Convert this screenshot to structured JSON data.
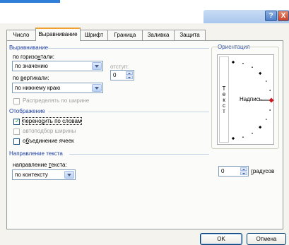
{
  "window": {
    "help_label": "?",
    "close_label": "X"
  },
  "tabs": [
    {
      "label": "Число"
    },
    {
      "label": "Выравнивание",
      "active": true
    },
    {
      "label": "Шрифт"
    },
    {
      "label": "Граница"
    },
    {
      "label": "Заливка"
    },
    {
      "label": "Защита"
    }
  ],
  "alignment": {
    "section_title": "Выравнивание",
    "horizontal_label_pre": "по горизо",
    "horizontal_label_u": "н",
    "horizontal_label_post": "тали:",
    "horizontal_value": "по значению",
    "indent_label": "отступ:",
    "indent_value": "0",
    "vertical_label_pre": "по ",
    "vertical_label_u": "в",
    "vertical_label_post": "ертикали:",
    "vertical_value": "по нижнему краю",
    "distributed_label": "Распределять по ширине"
  },
  "display": {
    "section_title": "Отображение",
    "wrap_label_pre": "перено",
    "wrap_label_u": "с",
    "wrap_label_post": "ить по словам",
    "wrap_checked": true,
    "shrink_label": "автоподбор ширины",
    "shrink_checked": false,
    "merge_label_pre": "о",
    "merge_label_u": "б",
    "merge_label_post": "ъединение ячеек",
    "merge_checked": false
  },
  "direction": {
    "section_title": "Направление текста",
    "label_pre": "направление ",
    "label_u": "т",
    "label_post": "екста:",
    "value": "по контексту"
  },
  "orientation": {
    "section_title": "Ориентация",
    "vertical_letters": [
      "Т",
      "е",
      "к",
      "с",
      "т"
    ],
    "sample_label": "Надпись",
    "degrees_value": "0",
    "degrees_label_u": "г",
    "degrees_label_post": "радусов",
    "angle_degrees": 0
  },
  "buttons": {
    "ok_label": "OK",
    "cancel_label": "Отмена"
  },
  "colors": {
    "section_title": "#1c3fa8",
    "accent_red": "#d0161c",
    "tab_highlight": "#f0a030"
  }
}
